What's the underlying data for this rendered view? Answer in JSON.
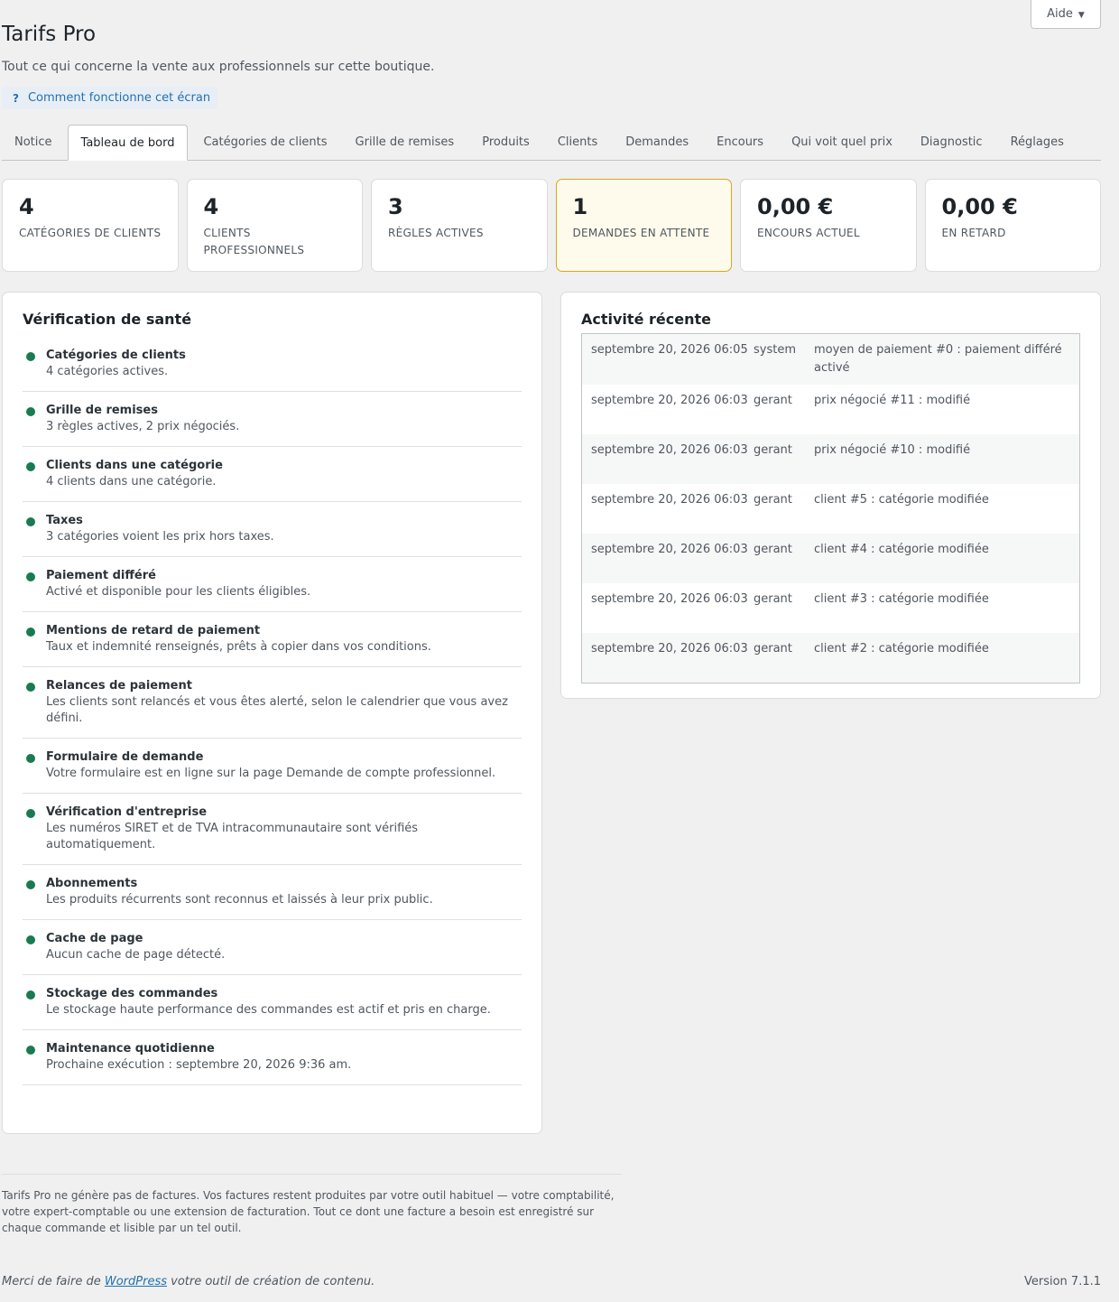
{
  "help_button": {
    "label": "Aide"
  },
  "header": {
    "title": "Tarifs Pro",
    "description": "Tout ce qui concerne la vente aux professionnels sur cette boutique.",
    "how_it_works": "Comment fonctionne cet écran"
  },
  "tabs": [
    {
      "label": "Notice"
    },
    {
      "label": "Tableau de bord"
    },
    {
      "label": "Catégories de clients"
    },
    {
      "label": "Grille de remises"
    },
    {
      "label": "Produits"
    },
    {
      "label": "Clients"
    },
    {
      "label": "Demandes"
    },
    {
      "label": "Encours"
    },
    {
      "label": "Qui voit quel prix"
    },
    {
      "label": "Diagnostic"
    },
    {
      "label": "Réglages"
    }
  ],
  "stats": [
    {
      "value": "4",
      "label": "Catégories de clients"
    },
    {
      "value": "4",
      "label": "Clients professionnels"
    },
    {
      "value": "3",
      "label": "Règles actives"
    },
    {
      "value": "1",
      "label": "Demandes en attente"
    },
    {
      "value": "0,00 €",
      "label": "Encours actuel"
    },
    {
      "value": "0,00 €",
      "label": "En retard"
    }
  ],
  "health": {
    "title": "Vérification de santé",
    "items": [
      {
        "title": "Catégories de clients",
        "desc": "4 catégories actives."
      },
      {
        "title": "Grille de remises",
        "desc": "3 règles actives, 2 prix négociés."
      },
      {
        "title": "Clients dans une catégorie",
        "desc": "4 clients dans une catégorie."
      },
      {
        "title": "Taxes",
        "desc": "3 catégories voient les prix hors taxes."
      },
      {
        "title": "Paiement différé",
        "desc": "Activé et disponible pour les clients éligibles."
      },
      {
        "title": "Mentions de retard de paiement",
        "desc": "Taux et indemnité renseignés, prêts à copier dans vos conditions."
      },
      {
        "title": "Relances de paiement",
        "desc": "Les clients sont relancés et vous êtes alerté, selon le calendrier que vous avez défini."
      },
      {
        "title": "Formulaire de demande",
        "desc": "Votre formulaire est en ligne sur la page Demande de compte professionnel."
      },
      {
        "title": "Vérification d'entreprise",
        "desc": "Les numéros SIRET et de TVA intracommunautaire sont vérifiés automatiquement."
      },
      {
        "title": "Abonnements",
        "desc": "Les produits récurrents sont reconnus et laissés à leur prix public."
      },
      {
        "title": "Cache de page",
        "desc": "Aucun cache de page détecté."
      },
      {
        "title": "Stockage des commandes",
        "desc": "Le stockage haute performance des commandes est actif et pris en charge."
      },
      {
        "title": "Maintenance quotidienne",
        "desc": "Prochaine exécution : septembre 20, 2026 9:36 am."
      }
    ]
  },
  "activity": {
    "title": "Activité récente",
    "rows": [
      {
        "date": "septembre 20, 2026 06:05",
        "user": "system",
        "message": "moyen de paiement #0 : paiement différé activé"
      },
      {
        "date": "septembre 20, 2026 06:03",
        "user": "gerant",
        "message": "prix négocié #11 : modifié"
      },
      {
        "date": "septembre 20, 2026 06:03",
        "user": "gerant",
        "message": "prix négocié #10 : modifié"
      },
      {
        "date": "septembre 20, 2026 06:03",
        "user": "gerant",
        "message": "client #5 : catégorie modifiée"
      },
      {
        "date": "septembre 20, 2026 06:03",
        "user": "gerant",
        "message": "client #4 : catégorie modifiée"
      },
      {
        "date": "septembre 20, 2026 06:03",
        "user": "gerant",
        "message": "client #3 : catégorie modifiée"
      },
      {
        "date": "septembre 20, 2026 06:03",
        "user": "gerant",
        "message": "client #2 : catégorie modifiée"
      }
    ]
  },
  "footer": {
    "note": "Tarifs Pro ne génère pas de factures. Vos factures restent produites par votre outil habituel — votre comptabilité, votre expert-comptable ou une extension de facturation. Tout ce dont une facture a besoin est enregistré sur chaque commande et lisible par un tel outil.",
    "thanks_prefix": "Merci de faire de ",
    "thanks_link": "WordPress",
    "thanks_suffix": " votre outil de création de contenu.",
    "version": "Version 7.1.1"
  }
}
